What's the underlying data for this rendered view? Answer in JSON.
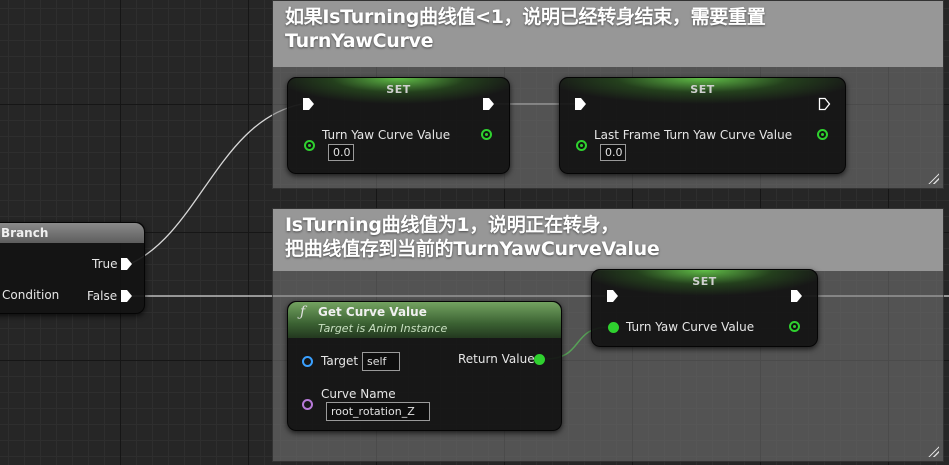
{
  "comments": [
    {
      "id": "top",
      "text_line1": "如果IsTurning曲线值<1，说明已经转身结束，需要重置",
      "text_line2": "TurnYawCurve"
    },
    {
      "id": "bottom",
      "text_line1": "IsTurning曲线值为1，说明正在转身，",
      "text_line2": "把曲线值存到当前的TurnYawCurveValue"
    }
  ],
  "nodes": {
    "set1": {
      "title": "SET",
      "var_label": "Turn Yaw Curve Value",
      "value": "0.0"
    },
    "set2": {
      "title": "SET",
      "var_label": "Last Frame Turn Yaw Curve Value",
      "value": "0.0"
    },
    "set3": {
      "title": "SET",
      "var_label": "Turn Yaw Curve Value"
    },
    "branch": {
      "title": "Branch",
      "true_label": "True",
      "false_label": "False",
      "condition_label": "Condition"
    },
    "get_curve": {
      "glyph": "ƒ",
      "title": "Get Curve Value",
      "subtitle": "Target is Anim Instance",
      "target_label": "Target",
      "target_value": "self",
      "return_label": "Return Value",
      "curve_name_label": "Curve Name",
      "curve_name_value": "root_rotation_Z"
    }
  },
  "colors": {
    "float_pin": "#2fd12f",
    "object_pin": "#3aa0ff",
    "name_pin": "#b77ad9",
    "exec_pin": "#ffffff"
  }
}
